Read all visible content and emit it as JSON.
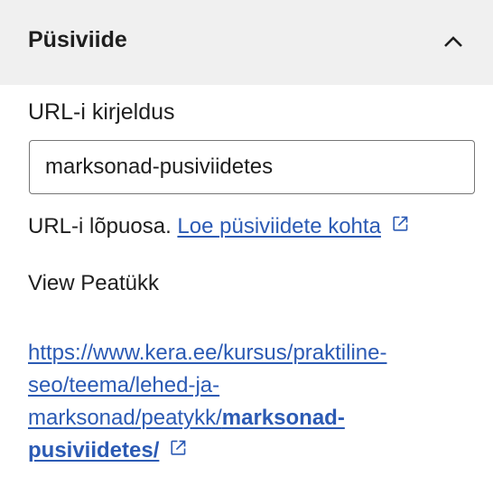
{
  "panel": {
    "title": "Püsiviide",
    "collapse_icon": "chevron-up-icon"
  },
  "slug": {
    "label": "URL-i kirjeldus",
    "value": "marksonad-pusiviidetes"
  },
  "help": {
    "text": "URL-i lõpuosa.",
    "link_text": "Loe püsiviidete kohta",
    "link_icon": "external-link-icon"
  },
  "view": {
    "label": "View Peatükk",
    "url_line1": "https://www.kera.ee/kursus/praktiline-",
    "url_line2": "seo/teema/lehed-ja-",
    "url_line3_prefix": "marksonad/peatykk/",
    "url_line3_bold": "marksonad-",
    "url_line4_bold": "pusiviidetes/",
    "link_icon": "external-link-icon"
  },
  "colors": {
    "header_bg": "#f0f0f0",
    "link": "#2b5ab4",
    "text": "#1e1e1e"
  }
}
